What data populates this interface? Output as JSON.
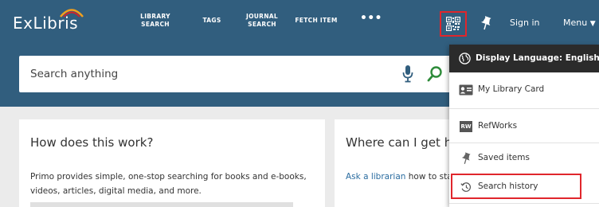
{
  "header": {
    "logo_text": "ExLibris",
    "nav": [
      {
        "label_line1": "LIBRARY",
        "label_line2": "SEARCH"
      },
      {
        "label_line1": "TAGS"
      },
      {
        "label_line1": "JOURNAL",
        "label_line2": "SEARCH"
      },
      {
        "label_line1": "FETCH ITEM"
      },
      {
        "label_line1": "•••"
      }
    ],
    "qr_icon": "qr-code-icon",
    "pin_icon": "pin-icon",
    "signin_label": "Sign in",
    "menu_label": "Menu"
  },
  "search": {
    "placeholder": "Search anything",
    "mic_icon": "microphone-icon",
    "search_icon": "search-icon"
  },
  "cards": {
    "left": {
      "title": "How does this work?",
      "body": "Primo provides simple, one-stop searching for books and e-books, videos, articles, digital media, and more."
    },
    "right": {
      "title": "Where can I get help",
      "link": "Ask a librarian",
      "body_after_link": " how to start searching"
    }
  },
  "dropdown": {
    "header": "Display Language: English",
    "items": [
      {
        "label": "My Library Card",
        "icon": "library-card-icon"
      },
      {
        "label": "RefWorks",
        "icon": "refworks-icon",
        "icon_text": "RW"
      },
      {
        "label": "Saved items",
        "icon": "pin-icon"
      },
      {
        "label": "Search history",
        "icon": "history-icon"
      }
    ]
  },
  "colors": {
    "header_bg": "#315e7e",
    "highlight": "#e0262c",
    "search_green": "#2e8b3a",
    "mic_blue": "#315e7e"
  }
}
